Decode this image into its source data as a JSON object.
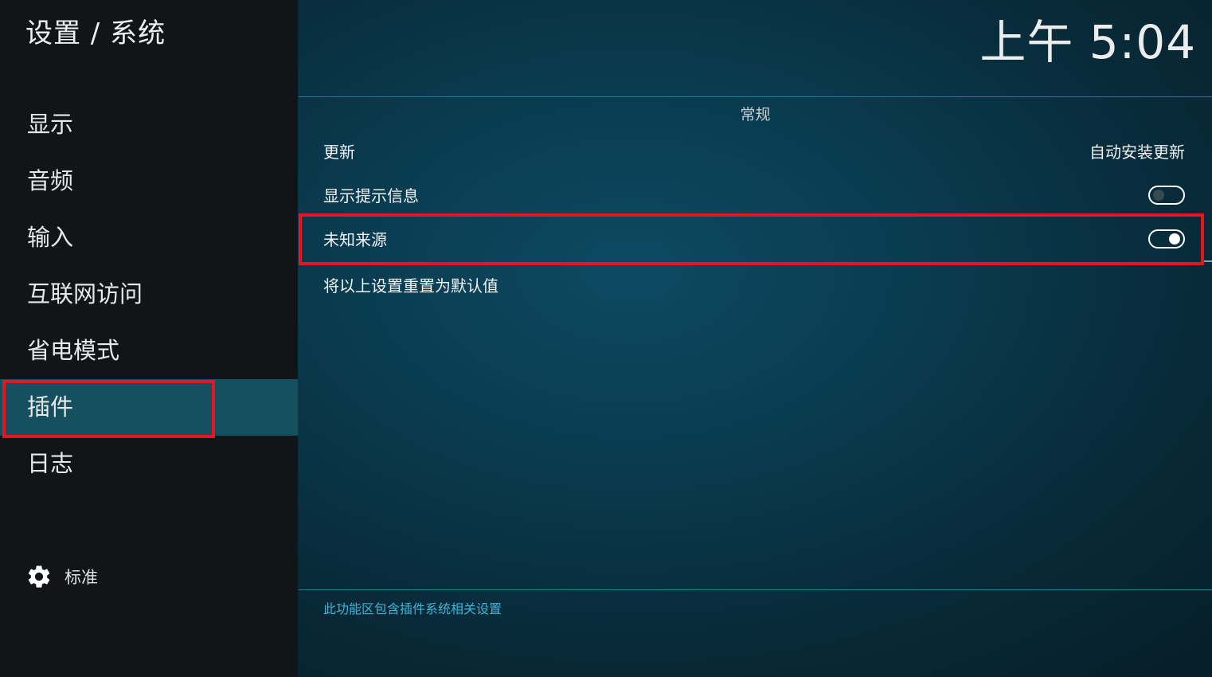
{
  "header": {
    "breadcrumb": "设置 / 系统",
    "clock": "上午 5:04"
  },
  "sidebar": {
    "items": [
      {
        "label": "显示"
      },
      {
        "label": "音频"
      },
      {
        "label": "输入"
      },
      {
        "label": "互联网访问"
      },
      {
        "label": "省电模式"
      },
      {
        "label": "插件",
        "selected": true
      },
      {
        "label": "日志"
      }
    ],
    "settings_level": {
      "icon": "gear-icon",
      "label": "标准"
    }
  },
  "content": {
    "section_title": "常规",
    "settings": [
      {
        "label": "更新",
        "value": "自动安装更新"
      },
      {
        "label": "显示提示信息",
        "toggle": "off"
      },
      {
        "label": "未知来源",
        "toggle": "on",
        "focused": true
      },
      {
        "label": "将以上设置重置为默认值"
      }
    ],
    "description": "此功能区包含插件系统相关设置"
  },
  "colors": {
    "highlight": "#e8141e",
    "accent": "#1c7f96",
    "selected_bg": "#14505f",
    "description": "#3fb4d8"
  }
}
